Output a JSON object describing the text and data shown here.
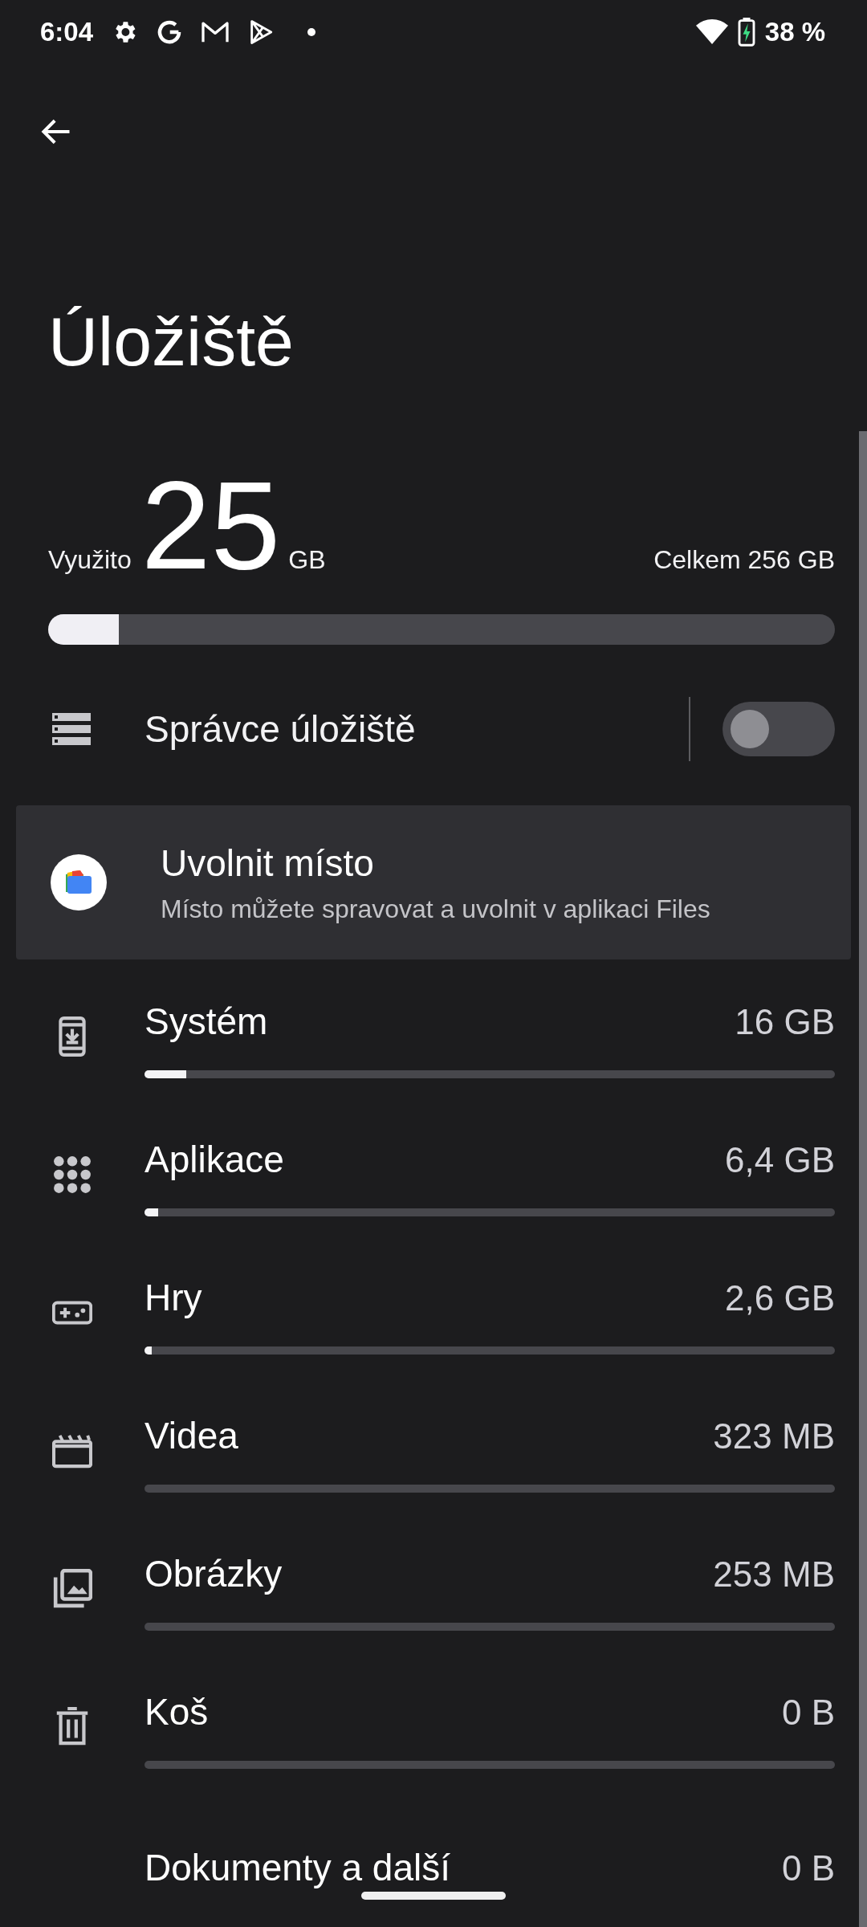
{
  "status_bar": {
    "time": "6:04",
    "battery": "38 %"
  },
  "title": "Úložiště",
  "usage": {
    "used_label": "Využito",
    "used_value": "25",
    "used_unit": "GB",
    "total": "Celkem 256 GB",
    "level": 0.09
  },
  "manager": {
    "label": "Správce úložiště",
    "on": false
  },
  "free_up": {
    "title": "Uvolnit místo",
    "subtitle": "Místo můžete spravovat a uvolnit v aplikaci Files"
  },
  "categories": [
    {
      "kind": "system",
      "name": "Systém",
      "size": "16 GB",
      "level": 0.06
    },
    {
      "kind": "apps",
      "name": "Aplikace",
      "size": "6,4 GB",
      "level": 0.02
    },
    {
      "kind": "games",
      "name": "Hry",
      "size": "2,6 GB",
      "level": 0.01
    },
    {
      "kind": "videos",
      "name": "Videa",
      "size": "323 MB",
      "level": 0
    },
    {
      "kind": "images",
      "name": "Obrázky",
      "size": "253 MB",
      "level": 0
    },
    {
      "kind": "trash",
      "name": "Koš",
      "size": "0 B",
      "level": 0
    },
    {
      "kind": "documents",
      "name": "Dokumenty a další",
      "size": "0 B"
    }
  ]
}
